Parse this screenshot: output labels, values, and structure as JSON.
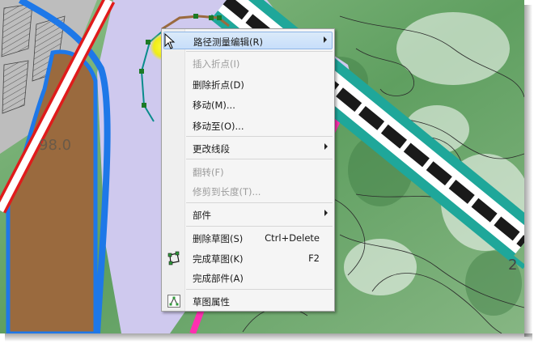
{
  "map_labels": {
    "contour_left": "98.0",
    "contour_right": "2"
  },
  "context_menu": {
    "items": [
      {
        "label": "路径测量编辑(R)",
        "enabled": true,
        "highlighted": true,
        "submenu": true
      },
      {
        "label": "插入折点(I)",
        "enabled": false
      },
      {
        "label": "删除折点(D)",
        "enabled": true
      },
      {
        "label": "移动(M)...",
        "enabled": true
      },
      {
        "label": "移动至(O)...",
        "enabled": true
      },
      {
        "label": "更改线段",
        "enabled": true,
        "submenu": true
      },
      {
        "label": "翻转(F)",
        "enabled": false
      },
      {
        "label": "修剪到长度(T)...",
        "enabled": false
      },
      {
        "label": "部件",
        "enabled": true,
        "submenu": true
      },
      {
        "label": "删除草图(S)",
        "shortcut": "Ctrl+Delete",
        "enabled": true
      },
      {
        "label": "完成草图(K)",
        "shortcut": "F2",
        "enabled": true,
        "icon": "finish-sketch-icon"
      },
      {
        "label": "完成部件(A)",
        "enabled": true
      },
      {
        "label": "草图属性",
        "enabled": true,
        "icon": "sketch-properties-icon"
      }
    ]
  },
  "colors": {
    "menu_highlight": "#c7defa",
    "cursor_halo": "#f2f000",
    "sketch_line": "#0a8c8c",
    "sketch_vertex": "#1d7a26",
    "road_magenta": "#ff2fb0",
    "railway_teal": "#1fa79a",
    "parcel_brown": "#9a6a3e",
    "water_lavender": "#cfc9ee",
    "river_blue": "#1e78e8",
    "terrain_green": "#6faa6e"
  }
}
